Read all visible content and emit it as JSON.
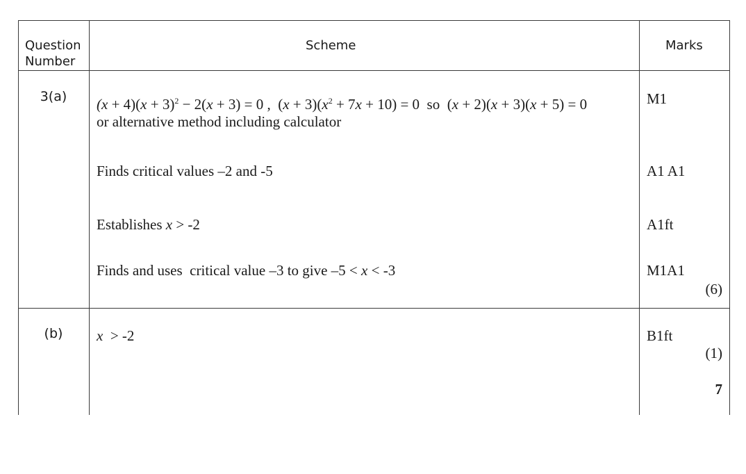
{
  "header": {
    "question_number": "Question\nNumber",
    "scheme": "Scheme",
    "marks": "Marks"
  },
  "part_a": {
    "label": "3(a)",
    "rows": [
      {
        "scheme_line1": "(x + 4)(x + 3)² − 2(x + 3) = 0 ,  (x + 3)(x² + 7x + 10) = 0  so  (x + 2)(x + 3)(x + 5) = 0",
        "scheme_line2": "or alternative method including calculator",
        "mark": "M1"
      },
      {
        "scheme": "Finds critical values –2 and -5",
        "mark": "A1 A1"
      },
      {
        "scheme": "Establishes x > -2",
        "mark": "A1ft"
      },
      {
        "scheme": "Finds and uses  critical value –3 to give –5 < x < -3",
        "mark": "M1A1"
      }
    ],
    "subtotal": "(6)"
  },
  "part_b": {
    "label": "(b)",
    "scheme": "x  > -2",
    "mark": "B1ft",
    "subtotal": "(1)"
  },
  "total": "7"
}
